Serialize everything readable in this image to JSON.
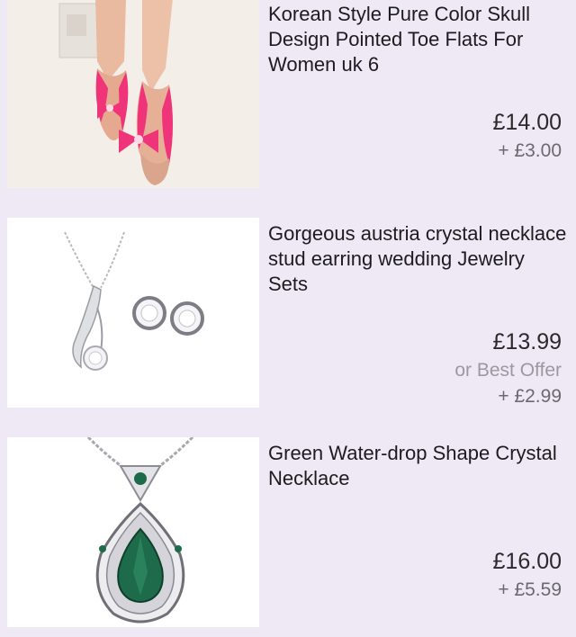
{
  "listings": [
    {
      "image_name": "pink-bow-flats-photo",
      "title": "Korean Style Pure Color Skull Design Pointed Toe Flats For Women uk 6",
      "price": "£14.00",
      "shipping": "+ £3.00"
    },
    {
      "image_name": "crystal-jewelry-set-photo",
      "title": "Gorgeous austria crystal necklace stud earring wedding Jewelry Sets",
      "price": "£13.99",
      "best_offer": "or Best Offer",
      "shipping": "+ £2.99"
    },
    {
      "image_name": "green-crystal-necklace-photo",
      "title": "Green Water-drop Shape Crystal Necklace",
      "price": "£16.00",
      "shipping": "+ £5.59"
    }
  ],
  "colors": {
    "background": "#efe9f6",
    "flats_pink": "#f0347a",
    "crystal_green": "#1d6b4a"
  }
}
